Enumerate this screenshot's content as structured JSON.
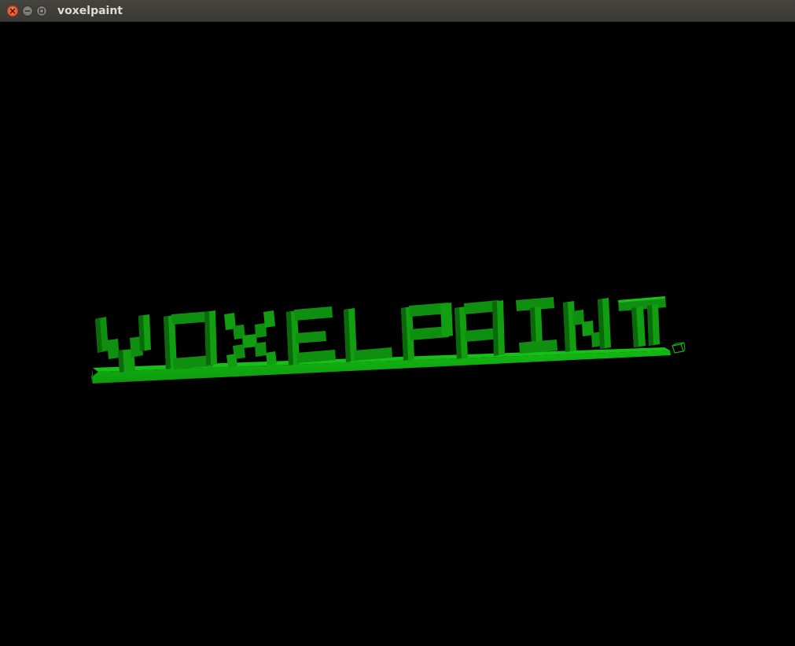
{
  "window": {
    "title": "voxelpaint"
  },
  "icons": {
    "close": "close-icon",
    "minimize": "minimize-icon",
    "maximize": "maximize-icon",
    "cursor": "voxel-cursor-icon"
  },
  "scene": {
    "text_model": "VOXELPAINT",
    "colors": {
      "voxel_light": "#119f11",
      "voxel_dark": "#0a5e0a",
      "plate_top": "#10a810",
      "cursor": "#17b017",
      "background": "#000000"
    }
  }
}
